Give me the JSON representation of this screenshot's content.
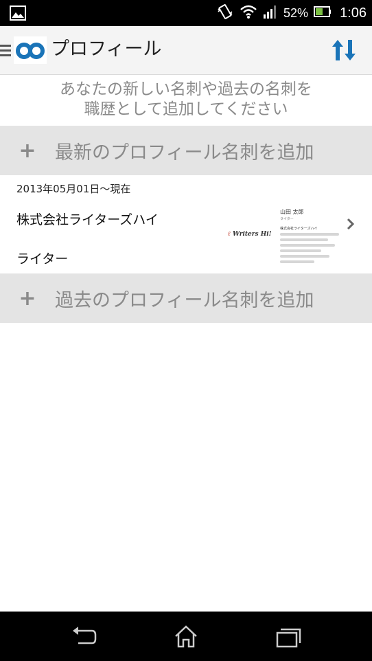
{
  "status_bar": {
    "battery_percent": "52%",
    "time": "1:06",
    "icons": [
      "gallery-icon",
      "vibrate-icon",
      "wifi-icon",
      "signal-icon",
      "battery-icon"
    ]
  },
  "action_bar": {
    "title": "プロフィール",
    "icons": [
      "menu-icon",
      "app-logo-icon",
      "sort-icon"
    ]
  },
  "intro": {
    "line1": "あなたの新しい名刺や過去の名刺を",
    "line2": "職歴として追加してください"
  },
  "add_latest": {
    "plus": "+",
    "label": "最新のプロフィール名刺を追加"
  },
  "profile_card": {
    "period": "2013年05月01日～現在",
    "company": "株式会社ライターズハイ",
    "position": "ライター",
    "thumbnail": {
      "name": "山田 太郎",
      "role": "ライター",
      "company": "株式会社ライターズハイ",
      "brand": "Writers Hi!"
    }
  },
  "add_past": {
    "plus": "+",
    "label": "過去のプロフィール名刺を追加"
  },
  "nav_bar": {
    "icons": [
      "back-icon",
      "home-icon",
      "recent-apps-icon"
    ]
  },
  "colors": {
    "accent": "#1a74b8",
    "row_bg": "#e4e4e4",
    "muted_text": "#8a8a8a"
  }
}
